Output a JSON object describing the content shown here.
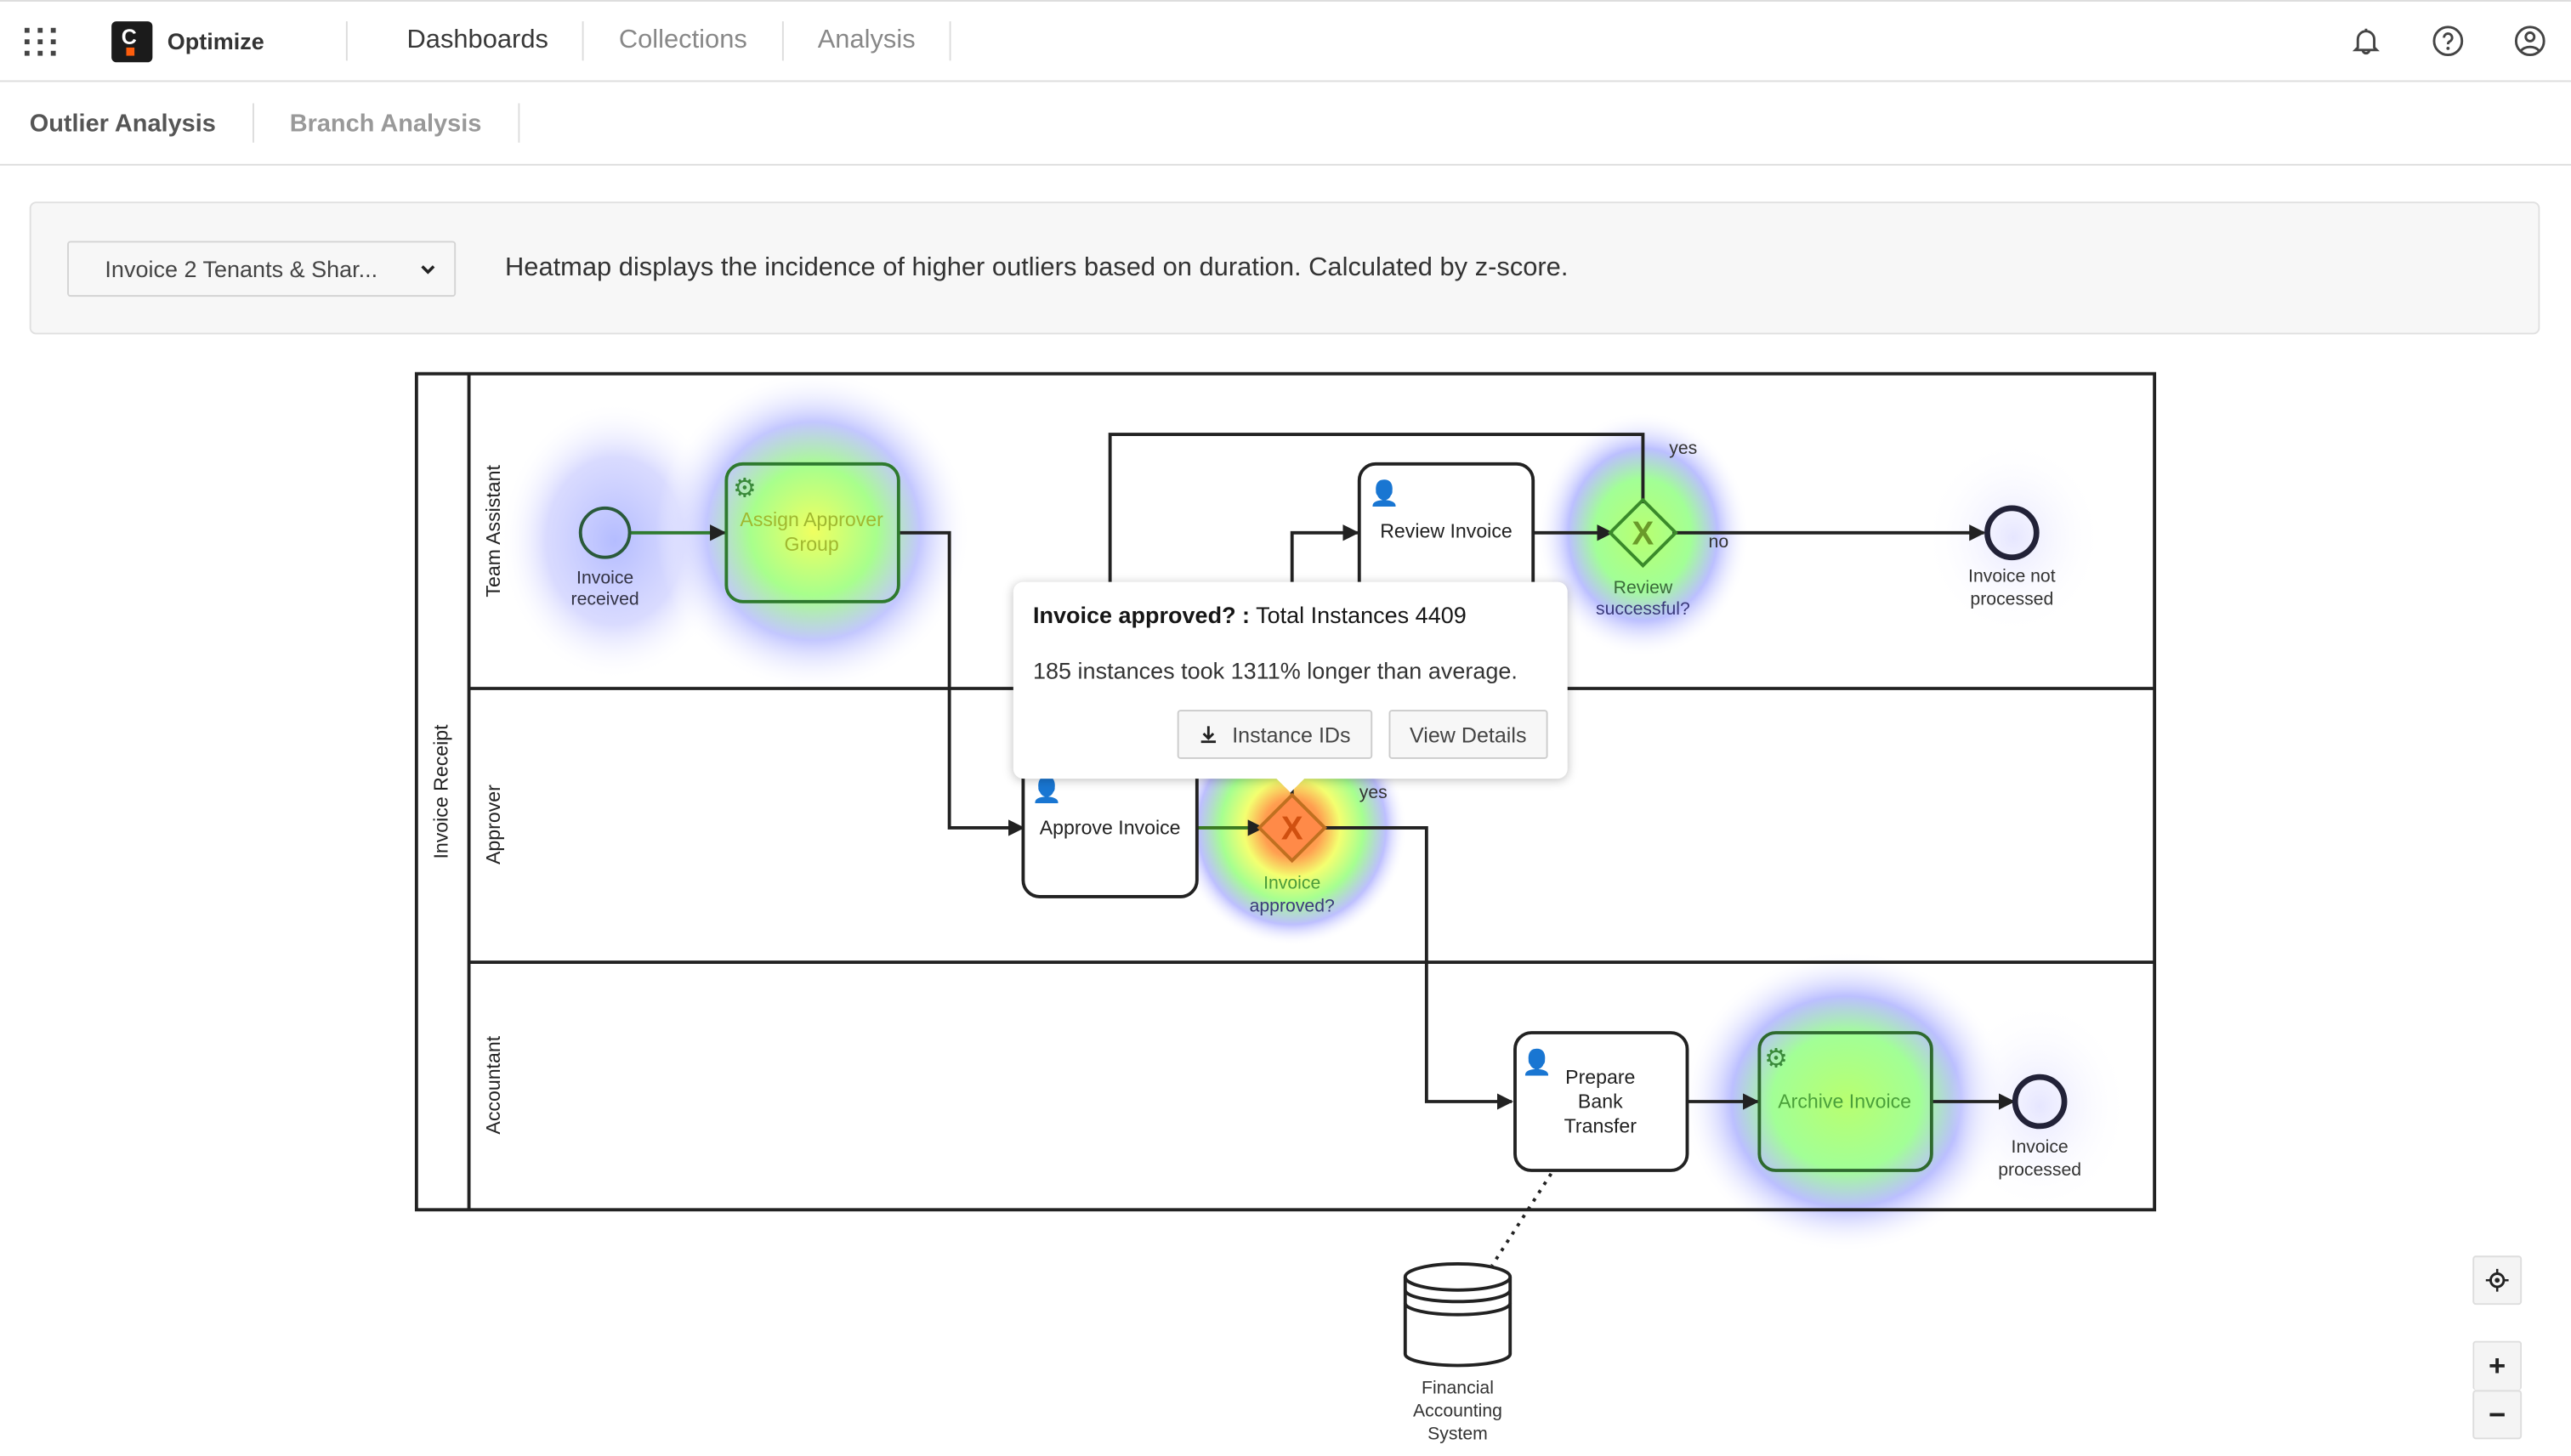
{
  "header": {
    "app_name": "Optimize",
    "logo_letter": "C",
    "nav": [
      {
        "label": "Dashboards",
        "active": true
      },
      {
        "label": "Collections",
        "active": false
      },
      {
        "label": "Analysis",
        "active": false
      }
    ],
    "icons": [
      "apps-grid-icon",
      "bell-icon",
      "help-icon",
      "user-icon"
    ]
  },
  "subnav": {
    "tabs": [
      {
        "label": "Outlier Analysis",
        "active": true
      },
      {
        "label": "Branch Analysis",
        "active": false
      }
    ]
  },
  "filter": {
    "process_select": "Invoice 2 Tenants & Shar...",
    "description": "Heatmap displays the incidence of higher outliers based on duration. Calculated by z-score."
  },
  "diagram": {
    "pool": "Invoice Receipt",
    "lanes": [
      "Team Assistant",
      "Approver",
      "Accountant"
    ],
    "nodes": {
      "invoice_received": "Invoice received",
      "assign_approver_group_l1": "Assign Approver",
      "assign_approver_group_l2": "Group",
      "review_invoice": "Review Invoice",
      "review_successful_l1": "Review",
      "review_successful_l2": "successful?",
      "invoice_not_processed_l1": "Invoice not",
      "invoice_not_processed_l2": "processed",
      "approve_invoice": "Approve Invoice",
      "invoice_approved_l1": "Invoice",
      "invoice_approved_l2": "approved?",
      "prepare_bank_transfer_l1": "Prepare",
      "prepare_bank_transfer_l2": "Bank",
      "prepare_bank_transfer_l3": "Transfer",
      "archive_invoice": "Archive Invoice",
      "invoice_processed_l1": "Invoice",
      "invoice_processed_l2": "processed",
      "financial_system_l1": "Financial",
      "financial_system_l2": "Accounting",
      "financial_system_l3": "System",
      "invoice_received_l1": "Invoice",
      "invoice_received_l2": "received"
    },
    "flow_labels": {
      "yes": "yes",
      "no": "no"
    },
    "heat_colors": {
      "cold": "#8c8cff",
      "mid": "#90ff70",
      "warm": "#ffff60",
      "hot": "#ff6a2a"
    }
  },
  "tooltip": {
    "node_name": "Invoice approved? :",
    "total": "Total Instances 4409",
    "summary": "185 instances took 1311% longer than average.",
    "instance_ids_btn": "Instance IDs",
    "view_details_btn": "View Details"
  },
  "controls": {
    "zoom_in": "+",
    "zoom_out": "−"
  }
}
